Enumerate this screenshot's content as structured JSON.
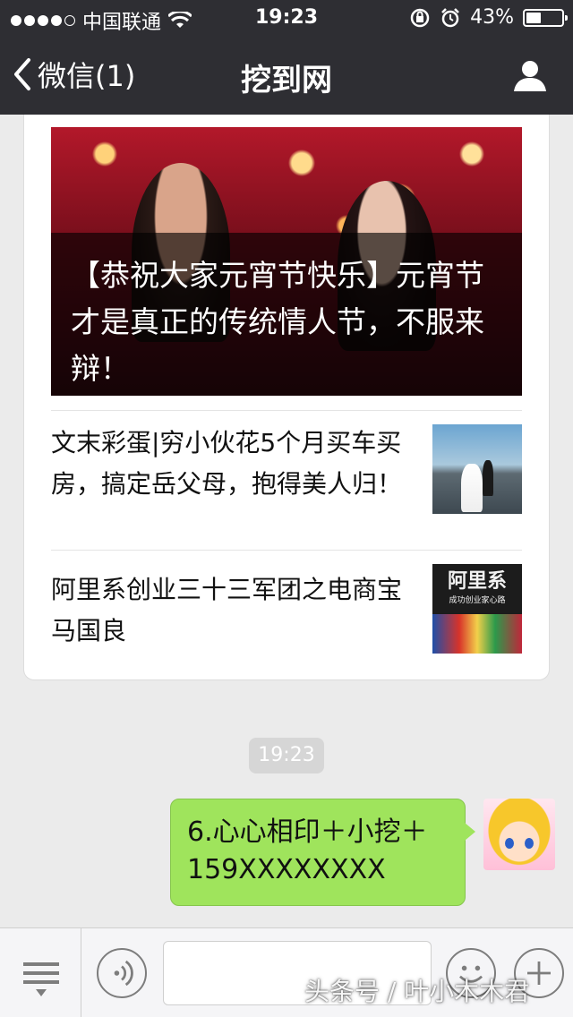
{
  "status_bar": {
    "carrier": "中国联通",
    "time": "19:23",
    "battery_percent": "43%",
    "battery_level": 0.43
  },
  "nav": {
    "back_label": "微信(1)",
    "title": "挖到网"
  },
  "article_card": {
    "cover_title": "【恭祝大家元宵节快乐】元宵节才是真正的传统情人节，不服来辩！",
    "items": [
      {
        "title": "文末彩蛋|穷小伙花5个月买车买房，搞定岳父母，抱得美人归！"
      },
      {
        "title": "阿里系创业三十三军团之电商宝马国良",
        "thumb_text": "阿里系",
        "thumb_subtext": "成功创业家心路"
      }
    ]
  },
  "chat": {
    "timestamp": "19:23",
    "message": "6.心心相印＋小挖＋159XXXXXXXX"
  },
  "toolbar": {
    "input_value": ""
  },
  "watermark": "头条号 / 叶小木木君",
  "colors": {
    "nav_bg": "#2e2e33",
    "bubble_green": "#9fe45c",
    "chat_bg": "#ebebeb"
  }
}
